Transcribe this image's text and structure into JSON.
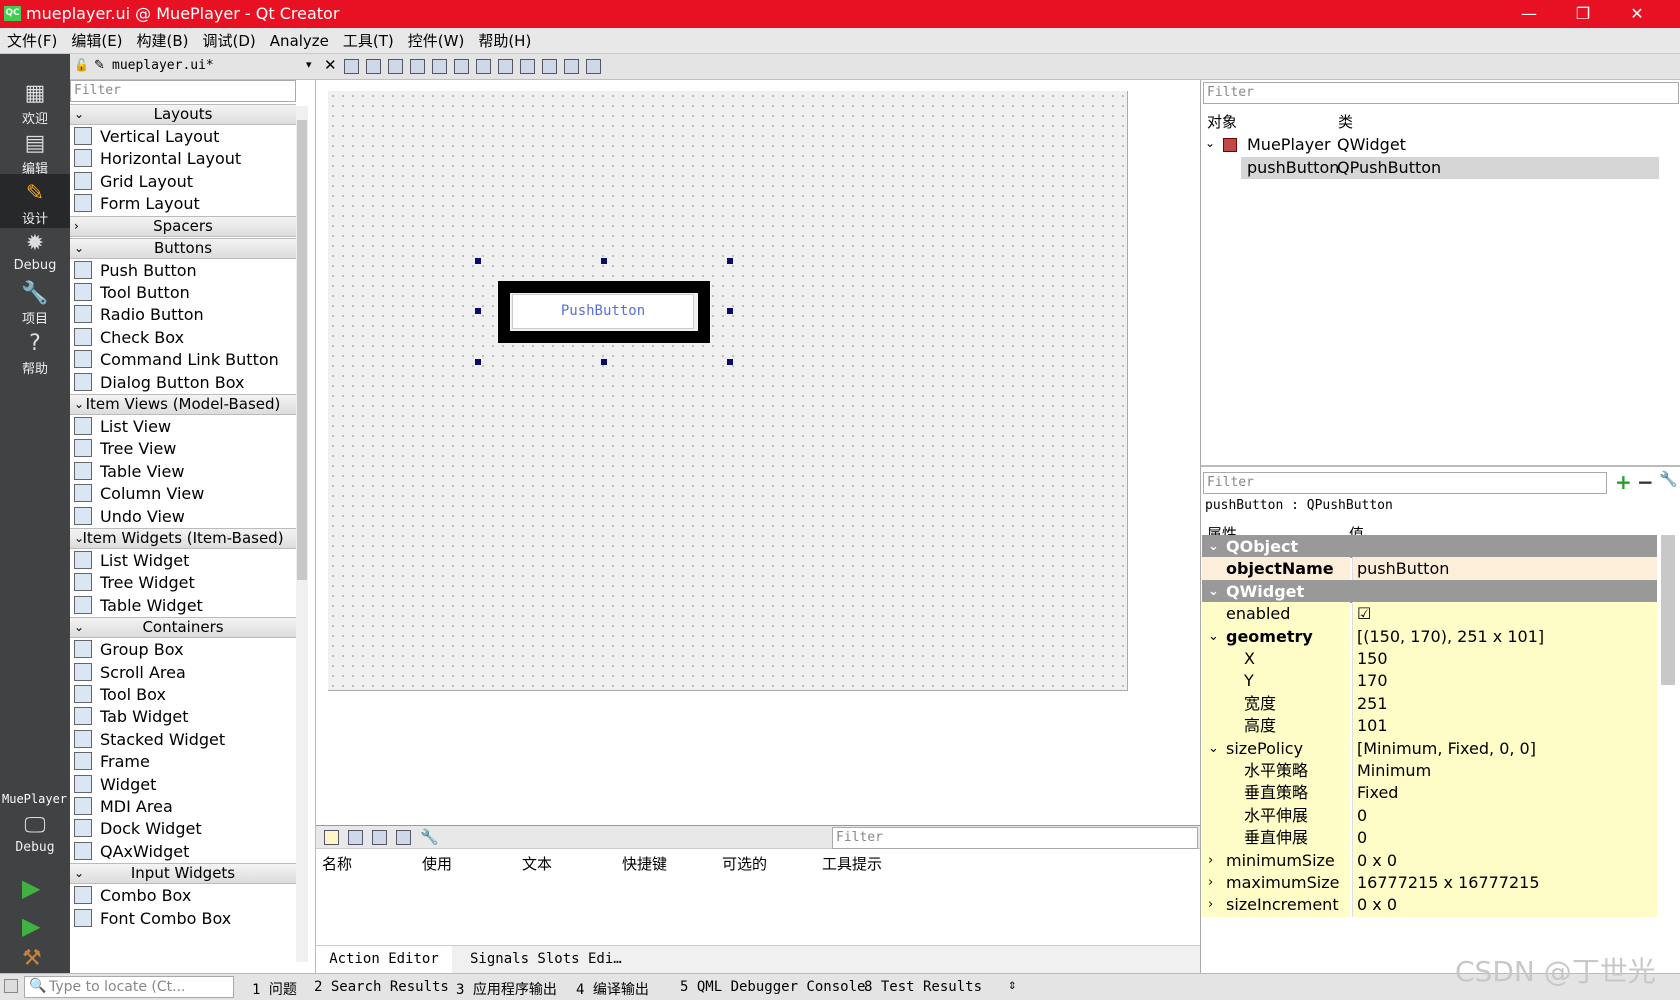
{
  "window": {
    "title": "mueplayer.ui @ MuePlayer - Qt Creator",
    "app_icon": "QC",
    "minimize": "—",
    "maximize": "❐",
    "close": "✕"
  },
  "menu": [
    "文件(F)",
    "编辑(E)",
    "构建(B)",
    "调试(D)",
    "Analyze",
    "工具(T)",
    "控件(W)",
    "帮助(H)"
  ],
  "modes": [
    {
      "label": "欢迎",
      "icon": "grid-icon",
      "glyph": "▦"
    },
    {
      "label": "编辑",
      "icon": "document-icon",
      "glyph": "▤"
    },
    {
      "label": "设计",
      "icon": "pencil-icon",
      "glyph": "✎"
    },
    {
      "label": "Debug",
      "icon": "bug-icon",
      "glyph": "✹"
    },
    {
      "label": "项目",
      "icon": "wrench-icon",
      "glyph": "🔧"
    },
    {
      "label": "帮助",
      "icon": "help-icon",
      "glyph": "?"
    }
  ],
  "kit": {
    "project": "MuePlayer",
    "label": "Debug"
  },
  "editor_tab": {
    "file": "mueplayer.ui*"
  },
  "widget_box": {
    "filter_placeholder": "Filter",
    "categories": [
      {
        "name": "Layouts",
        "items": [
          "Vertical Layout",
          "Horizontal Layout",
          "Grid Layout",
          "Form Layout"
        ]
      },
      {
        "name": "Spacers",
        "items": []
      },
      {
        "name": "Buttons",
        "items": [
          "Push Button",
          "Tool Button",
          "Radio Button",
          "Check Box",
          "Command Link Button",
          "Dialog Button Box"
        ]
      },
      {
        "name": "Item Views (Model-Based)",
        "items": [
          "List View",
          "Tree View",
          "Table View",
          "Column View",
          "Undo View"
        ]
      },
      {
        "name": "Item Widgets (Item-Based)",
        "items": [
          "List Widget",
          "Tree Widget",
          "Table Widget"
        ]
      },
      {
        "name": "Containers",
        "items": [
          "Group Box",
          "Scroll Area",
          "Tool Box",
          "Tab Widget",
          "Stacked Widget",
          "Frame",
          "Widget",
          "MDI Area",
          "Dock Widget",
          "QAxWidget"
        ]
      },
      {
        "name": "Input Widgets",
        "items": [
          "Combo Box",
          "Font Combo Box"
        ]
      }
    ]
  },
  "form": {
    "push_button_text": "PushButton"
  },
  "action_editor": {
    "filter_placeholder": "Filter",
    "columns": [
      "名称",
      "使用",
      "文本",
      "快捷键",
      "可选的",
      "工具提示"
    ],
    "tabs": [
      "Action Editor",
      "Signals  Slots Edi…"
    ]
  },
  "object_inspector": {
    "filter_placeholder": "Filter",
    "columns": [
      "对象",
      "类"
    ],
    "rows": [
      {
        "object": "MuePlayer",
        "class": "QWidget"
      },
      {
        "object": "pushButton",
        "class": "QPushButton"
      }
    ]
  },
  "property_editor": {
    "filter_placeholder": "Filter",
    "context": "pushButton : QPushButton",
    "columns": [
      "属性",
      "值"
    ],
    "rows": [
      {
        "name": "QObject",
        "value": "",
        "kind": "section"
      },
      {
        "name": "objectName",
        "value": "pushButton",
        "kind": "bold-org"
      },
      {
        "name": "QWidget",
        "value": "",
        "kind": "section"
      },
      {
        "name": "enabled",
        "value": "☑",
        "kind": "plain"
      },
      {
        "name": "geometry",
        "value": "[(150, 170), 251 x 101]",
        "kind": "bold"
      },
      {
        "name": "X",
        "value": "150",
        "kind": "sub"
      },
      {
        "name": "Y",
        "value": "170",
        "kind": "sub"
      },
      {
        "name": "宽度",
        "value": "251",
        "kind": "sub"
      },
      {
        "name": "高度",
        "value": "101",
        "kind": "sub"
      },
      {
        "name": "sizePolicy",
        "value": "[Minimum, Fixed, 0, 0]",
        "kind": "plain"
      },
      {
        "name": "水平策略",
        "value": "Minimum",
        "kind": "sub"
      },
      {
        "name": "垂直策略",
        "value": "Fixed",
        "kind": "sub"
      },
      {
        "name": "水平伸展",
        "value": "0",
        "kind": "sub"
      },
      {
        "name": "垂直伸展",
        "value": "0",
        "kind": "sub"
      },
      {
        "name": "minimumSize",
        "value": "0 x 0",
        "kind": "plain"
      },
      {
        "name": "maximumSize",
        "value": "16777215 x 16777215",
        "kind": "plain"
      },
      {
        "name": "sizeIncrement",
        "value": "0 x 0",
        "kind": "plain"
      }
    ]
  },
  "statusbar": {
    "locator_placeholder": "Type to locate (Ct...",
    "tabs": [
      "1 问题",
      "2 Search Results",
      "3 应用程序输出",
      "4 编译输出",
      "5 QML Debugger Console",
      "8 Test Results"
    ]
  },
  "watermark": "CSDN @丁世光"
}
